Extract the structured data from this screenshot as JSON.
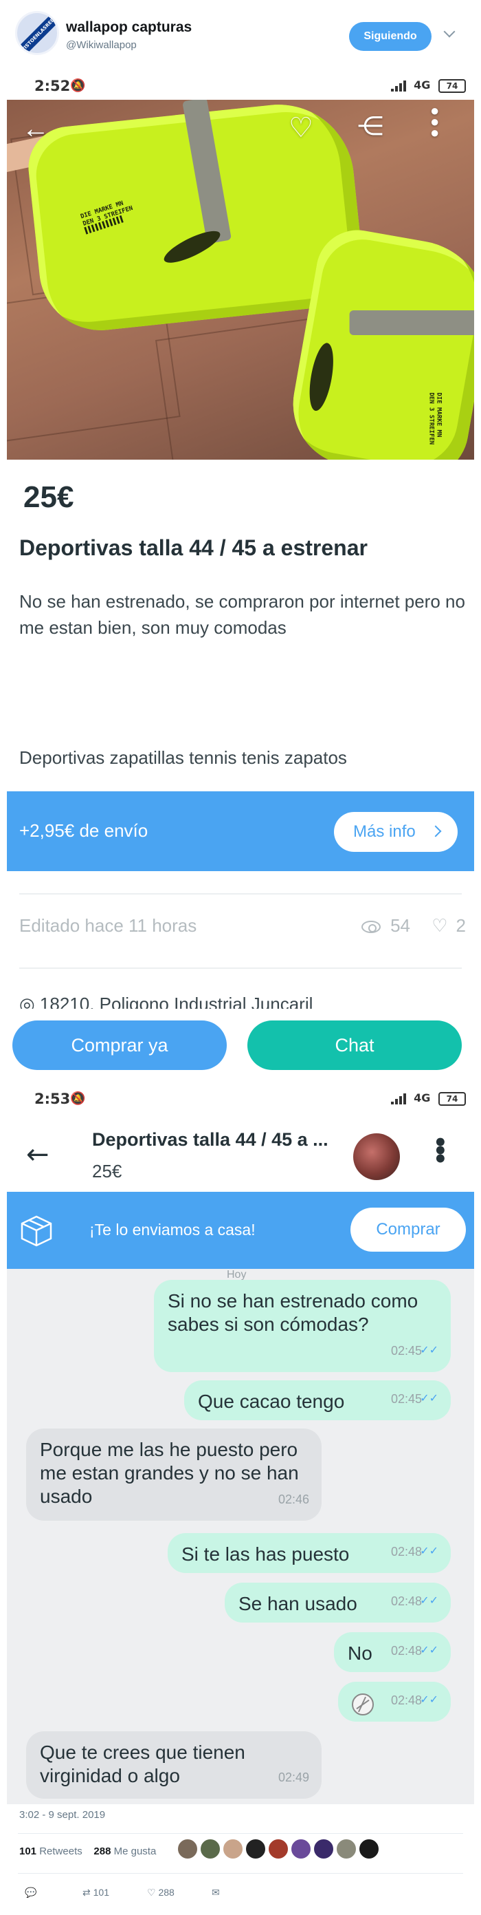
{
  "tweet": {
    "author_name": "wallapop capturas",
    "handle": "@Wikiwallapop",
    "avatar_ribbon": "VISTOENLASREDES",
    "follow_label": "Siguiendo",
    "date": "3:02 - 9 sept. 2019",
    "retweets_count": "101",
    "retweets_label": "Retweets",
    "likes_count": "288",
    "likes_label": "Me gusta",
    "reply_count": "",
    "retweet_action_count": "101",
    "like_action_count": "288"
  },
  "screenshot1": {
    "status": {
      "time": "2:52",
      "network": "4G",
      "battery": "74"
    },
    "photo_print": "DIE MARKE MN\nDEN 3 STREIFEN",
    "price": "25€",
    "title": "Deportivas talla 44 / 45 a estrenar",
    "description": "No se han estrenado, se compraron por internet pero no me estan bien, son muy comodas",
    "tags": "Deportivas zapatillas tennis tenis zapatos",
    "shipping_text": "+2,95€ de envío",
    "more_info_label": "Más info",
    "edited_text": "Editado hace 11 horas",
    "views": "54",
    "favorites": "2",
    "location": "◎ 18210, Poligono Industrial Juncaril",
    "buy_label": "Comprar ya",
    "chat_label": "Chat"
  },
  "screenshot2": {
    "status": {
      "time": "2:53",
      "network": "4G",
      "battery": "74"
    },
    "item_title": "Deportivas talla 44 / 45 a ...",
    "item_price": "25€",
    "promo_text": "¡Te lo enviamos a casa!",
    "promo_button": "Comprar",
    "today_label": "Hoy",
    "messages": [
      {
        "direction": "out",
        "text": "Si no se han estrenado como sabes si son cómodas?",
        "time": "02:45"
      },
      {
        "direction": "out",
        "text": "Que cacao tengo",
        "time": "02:45"
      },
      {
        "direction": "in",
        "text": "Porque me las he puesto pero me estan grandes y no se han usado",
        "time": "02:46"
      },
      {
        "direction": "out",
        "text": "Si te las has puesto",
        "time": "02:48"
      },
      {
        "direction": "out",
        "text": "Se han usado",
        "time": "02:48"
      },
      {
        "direction": "out",
        "text": "No",
        "time": "02:48"
      },
      {
        "direction": "out",
        "text": "",
        "emoji": "volleyball",
        "time": "02:48"
      },
      {
        "direction": "in",
        "text": "Que te crees que tienen virginidad o algo",
        "time": "02:49"
      }
    ]
  },
  "colors": {
    "wallapop_blue": "#4aa4f2",
    "wallapop_teal": "#13c1ac",
    "bubble_out": "#c8f5e5",
    "bubble_in": "#e0e2e5"
  }
}
